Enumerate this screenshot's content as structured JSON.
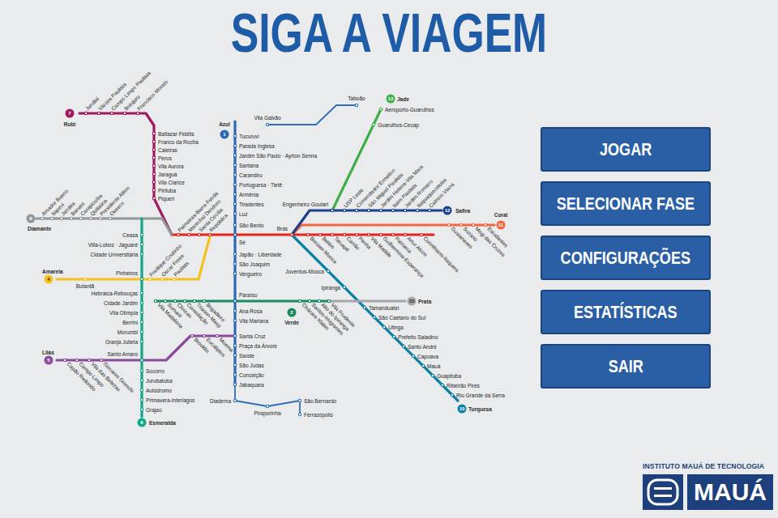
{
  "title": "SIGA A VIAGEM",
  "menu": [
    {
      "label": "JOGAR"
    },
    {
      "label": "SELECIONAR FASE"
    },
    {
      "label": "CONFIGURAÇÕES"
    },
    {
      "label": "ESTATÍSTICAS"
    },
    {
      "label": "SAIR"
    }
  ],
  "logo": {
    "caption": "INSTITUTO MAUÁ DE TECNOLOGIA",
    "name": "MAUÁ"
  },
  "map": {
    "lines": [
      {
        "kind": "metro",
        "color": "#2d68b2",
        "badge": {
          "name": "Azul",
          "number": "1"
        },
        "stations": [
          "Tucuruvi",
          "Parada Inglesa",
          "Jardim São Paulo · Ayrton Senna",
          "Santana",
          "Carandiru",
          "Portuguesa · Tietê",
          "Armênia",
          "Tiradentes",
          "Luz",
          "São Bento",
          "Sé",
          "Japão · Liberdade",
          "São Joaquim",
          "Vergueiro",
          "Paraíso",
          "Ana Rosa",
          "Vila Mariana",
          "Santa Cruz",
          "Praça da Árvore",
          "Saúde",
          "São Judas",
          "Conceição",
          "Jabaquara"
        ]
      },
      {
        "kind": "metro",
        "color": "#1a8a60",
        "badge": {
          "name": "Verde",
          "number": "2"
        },
        "stations": [
          "Vila Madalena",
          "Sumaré",
          "Clínicas",
          "Consolação",
          "Trianon-Masp",
          "Brigadeiro",
          "Chácara Klabin",
          "Santos-Imigrantes",
          "Alto do Ipiranga",
          "Vila Prudente"
        ]
      },
      {
        "kind": "metro",
        "color": "#e2261c",
        "stations": [
          "Palmeiras-Barra Funda",
          "Marechal Deodoro",
          "Santa Cecília",
          "República",
          "Brás",
          "Bresser-Mooca",
          "Belém",
          "Tatuapé",
          "Carrão",
          "Penha",
          "Vila Matilde",
          "Guilhermina-Esperança",
          "Patriarca",
          "Artur Alvim",
          "Corinthians-Itaquera"
        ]
      },
      {
        "kind": "metro",
        "color": "#f5c21b",
        "badge": {
          "name": "Amarela",
          "number": "4"
        },
        "stations": [
          "Butantã",
          "Fradique Coutinho",
          "Oscar Freire",
          "Paulista"
        ]
      },
      {
        "kind": "metro",
        "color": "#8b4a9c",
        "badge": {
          "name": "Lilás",
          "number": "5"
        },
        "stations": [
          "Capão Redondo",
          "Campo Limpo",
          "Vila das Belezas",
          "Giovanni Gronchi",
          "Brooklin",
          "Eucaliptos",
          "Moema"
        ]
      },
      {
        "kind": "metro",
        "color": "#a0195c",
        "badge": {
          "name": "Rubi",
          "number": "7"
        },
        "stations": [
          "Jundiaí",
          "Várzea Paulista",
          "Campo Limpo Paulista",
          "Botujuru",
          "Francisco Morato",
          "Baltazar Fidélis",
          "Franco da Rocha",
          "Caieiras",
          "Perus",
          "Vila Aurora",
          "Jaraguá",
          "Vila Clarice",
          "Pirituba",
          "Piqueri"
        ]
      },
      {
        "kind": "metro",
        "color": "#8f979c",
        "badge": {
          "name": "Diamante",
          "number": "8"
        },
        "stations": [
          "Amador Bueno",
          "Itapevi",
          "Jandira",
          "Barueri",
          "Carapicuíba",
          "Quitaúna",
          "Presidente Altino",
          "Osasco"
        ]
      },
      {
        "kind": "metro",
        "color": "#12a68b",
        "badge": {
          "name": "Esmeralda",
          "number": "9"
        },
        "stations": [
          "Ceasa",
          "Villa-Lobos · Jaguaré",
          "Cidade Universitária",
          "Pinheiros",
          "Hebraica-Rebouças",
          "Cidade Jardim",
          "Vila Olímpia",
          "Berrini",
          "Morumbi",
          "Granja Julieta",
          "Santo Amaro",
          "Socorro",
          "Jurubatuba",
          "Autódromo",
          "Primavera-Interlagos",
          "Grajaú"
        ]
      },
      {
        "kind": "metro",
        "color": "#0b7fa5",
        "badge": {
          "name": "Turquesa",
          "number": "10"
        },
        "stations": [
          "Juventus-Mooca",
          "Ipiranga",
          "Tamanduateí",
          "São Caetano do Sul",
          "Utinga",
          "Prefeito Saladino",
          "Santo André",
          "Capuava",
          "Mauá",
          "Guapituba",
          "Ribeirão Pires",
          "Rio Grande da Serra"
        ]
      },
      {
        "kind": "metro",
        "color": "#f0683f",
        "badge": {
          "name": "Coral",
          "number": "11"
        },
        "stations": [
          "Guaianases",
          "Suzano",
          "Mogi das Cruzes",
          "Estudantes"
        ]
      },
      {
        "kind": "metro",
        "color": "#1d3f8c",
        "badge": {
          "name": "Safira",
          "number": "12"
        },
        "stations": [
          "Engenheiro Goulart",
          "USP Leste",
          "Comendador Ermelino",
          "São Miguel Paulista",
          "Jardim Helena-Vila Mara",
          "Itaim Paulista",
          "Jardim Romano",
          "Itaquaquecetuba",
          "Calmon Viana"
        ]
      },
      {
        "kind": "metro",
        "color": "#3fae49",
        "badge": {
          "name": "Jade",
          "number": "13"
        },
        "stations": [
          "Guarulhos-Cecap",
          "Aeroporto-Guarulhos"
        ]
      },
      {
        "kind": "metro",
        "color": "#a3a7ab",
        "badge": {
          "name": "Prata",
          "number": "15"
        },
        "stations": []
      },
      {
        "kind": "bus",
        "color": "#2f6fb8",
        "stations": [
          "Vila Galvão",
          "Taboão"
        ]
      },
      {
        "kind": "bus",
        "color": "#2f6fb8",
        "stations": [
          "Diadema",
          "Piraporinha",
          "São Bernardo",
          "Ferrazópolis"
        ]
      }
    ]
  }
}
